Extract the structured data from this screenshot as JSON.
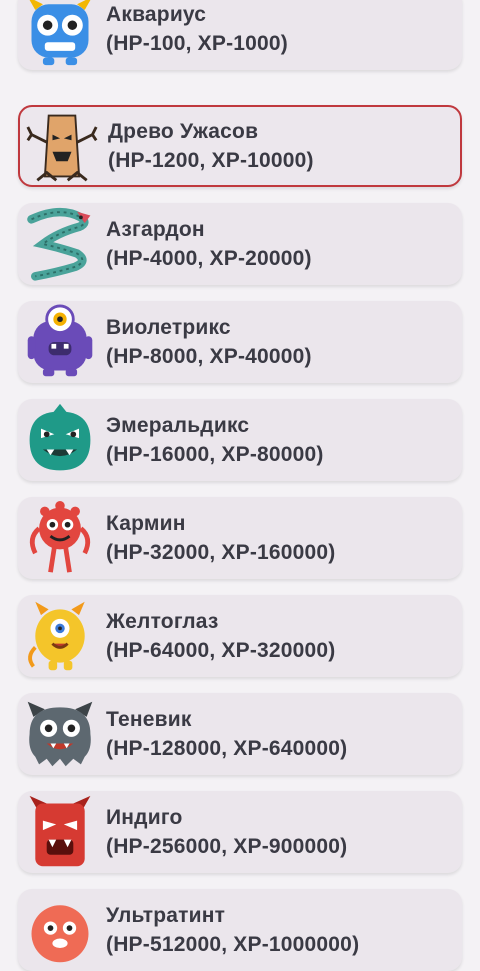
{
  "monsters": [
    {
      "name": "Аквариус",
      "stats": "(HP-100, XP-1000)",
      "icon": "blue-monster-icon",
      "color": "#3b8fe6"
    },
    {
      "name": "Древо Ужасов",
      "stats": "(HP-1200, XP-10000)",
      "icon": "tree-monster-icon",
      "color": "#e0a46a",
      "selected": true
    },
    {
      "name": "Азгардон",
      "stats": "(HP-4000, XP-20000)",
      "icon": "dragon-icon",
      "color": "#4aa39a"
    },
    {
      "name": "Виолетрикс",
      "stats": "(HP-8000, XP-40000)",
      "icon": "purple-cyclops-icon",
      "color": "#6a4bb8"
    },
    {
      "name": "Эмеральдикс",
      "stats": "(HP-16000, XP-80000)",
      "icon": "green-monster-icon",
      "color": "#1f9a88"
    },
    {
      "name": "Кармин",
      "stats": "(HP-32000, XP-160000)",
      "icon": "red-monster-icon",
      "color": "#e2463f"
    },
    {
      "name": "Желтоглаз",
      "stats": "(HP-64000, XP-320000)",
      "icon": "yellow-cyclops-icon",
      "color": "#f4c52a"
    },
    {
      "name": "Теневик",
      "stats": "(HP-128000, XP-640000)",
      "icon": "gray-monster-icon",
      "color": "#5d6870"
    },
    {
      "name": "Индиго",
      "stats": "(HP-256000, XP-900000)",
      "icon": "red-devil-icon",
      "color": "#d63a32"
    },
    {
      "name": "Ультратинт",
      "stats": "(HP-512000, XP-1000000)",
      "icon": "orange-monster-icon",
      "color": "#ef6b55"
    }
  ]
}
